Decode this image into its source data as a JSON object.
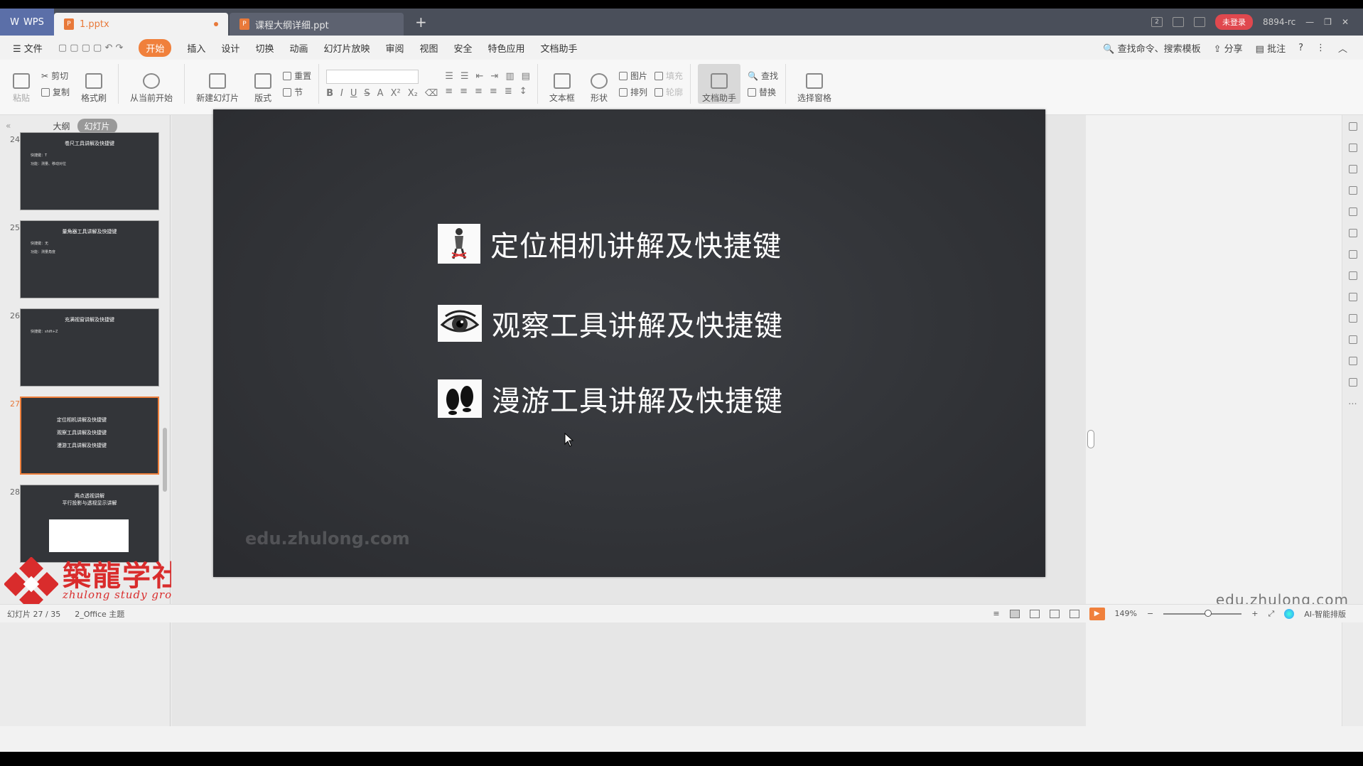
{
  "titlebar": {
    "app_label": "WPS",
    "tabs": [
      {
        "label": "1.pptx"
      },
      {
        "label": "课程大纲详细.ppt"
      }
    ],
    "login_label": "未登录",
    "user_code": "8894-rc",
    "badge": "2"
  },
  "menu": {
    "file_label": "文件",
    "items": [
      "开始",
      "插入",
      "设计",
      "切换",
      "动画",
      "幻灯片放映",
      "审阅",
      "视图",
      "安全",
      "特色应用",
      "文档助手"
    ],
    "search_label": "查找命令、搜索模板",
    "share_label": "分享",
    "comment_label": "批注"
  },
  "ribbon": {
    "paste": "粘贴",
    "cut": "剪切",
    "copy": "复制",
    "format_painter": "格式刷",
    "from_current": "从当前开始",
    "new_slide": "新建幻灯片",
    "layout": "版式",
    "reset": "重置",
    "section": "节",
    "textbox": "文本框",
    "shape": "形状",
    "picture": "图片",
    "arrange": "排列",
    "fill": "填充",
    "outline": "轮廓",
    "doc_assistant": "文档助手",
    "find": "查找",
    "replace": "替换",
    "select_pane": "选择窗格"
  },
  "leftpanel": {
    "tab_outline": "大纲",
    "tab_slides": "幻灯片",
    "thumbs": [
      {
        "num": "24",
        "title": "卷尺工具讲解及快捷键",
        "l1": "快捷键：T",
        "l2": "功能：测量、移动对位"
      },
      {
        "num": "25",
        "title": "量角器工具讲解及快捷键",
        "l1": "快捷键：无",
        "l2": "功能：测量角度"
      },
      {
        "num": "26",
        "title": "充满视窗讲解及快捷键",
        "l1": "快捷键：shift+Z",
        "l2": ""
      },
      {
        "num": "27",
        "items": [
          "定位相机讲解及快捷键",
          "观察工具讲解及快捷键",
          "漫游工具讲解及快捷键"
        ]
      },
      {
        "num": "28",
        "title": "两点透视讲解",
        "subtitle": "平行投影与透视显示讲解"
      }
    ]
  },
  "slide": {
    "items": [
      {
        "text": "定位相机讲解及快捷键",
        "icon": "person-camera-icon"
      },
      {
        "text": "观察工具讲解及快捷键",
        "icon": "eye-icon"
      },
      {
        "text": "漫游工具讲解及快捷键",
        "icon": "footprints-icon"
      }
    ],
    "watermark": "edu.zhulong.com"
  },
  "logo": {
    "cn": "築龍学社",
    "en": "zhulong study group"
  },
  "bottom_watermark": "edu.zhulong.com",
  "status": {
    "slide_counter": "幻灯片 27 / 35",
    "theme": "2_Office 主题",
    "zoom": "149%",
    "ai_label": "AI-智能排版"
  },
  "colors": {
    "accent": "#f0803c",
    "slide_bg": "#333539",
    "logo_red": "#d92c2c"
  }
}
